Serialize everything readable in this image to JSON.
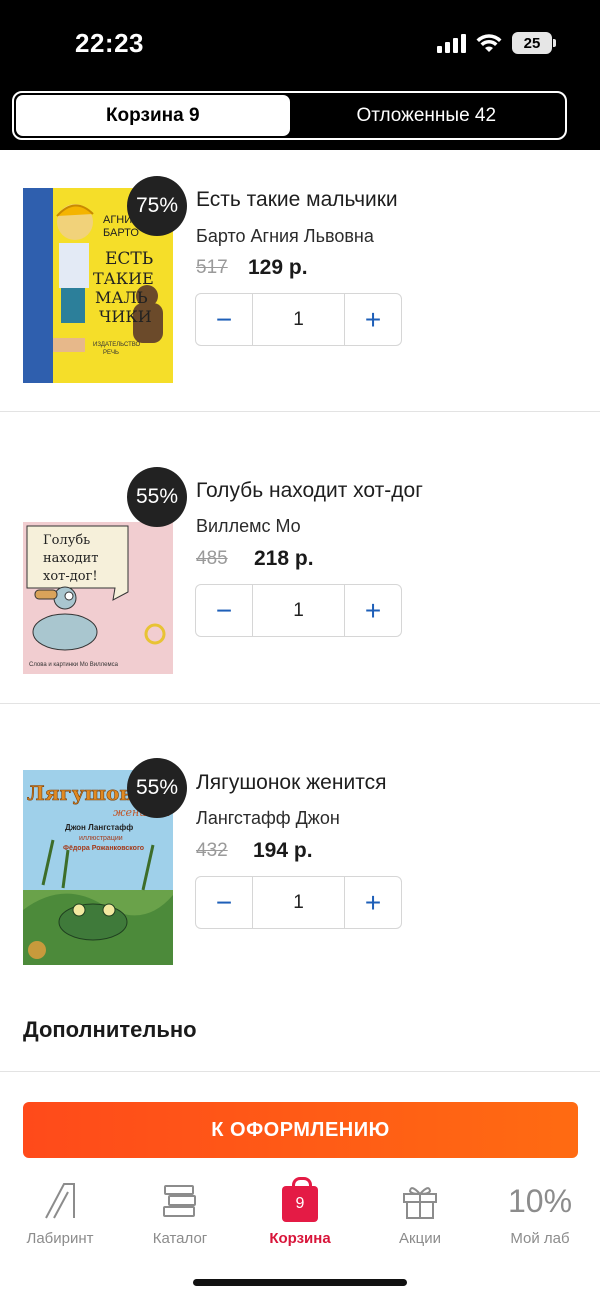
{
  "status_bar": {
    "time": "22:23",
    "battery": "25"
  },
  "segmented": {
    "tabs": [
      {
        "label": "Корзина 9",
        "active": true
      },
      {
        "label": "Отложенные 42",
        "active": false
      }
    ]
  },
  "cart_items": [
    {
      "discount": "75%",
      "title": "Есть такие мальчики",
      "author": "Барто Агния Львовна",
      "old_price": "517",
      "price": "129 р.",
      "quantity": "1",
      "cover_text": [
        "АГНИЯ",
        "БАРТО",
        "ЕСТЬ",
        "ТАКИЕ",
        "МАЛЬ",
        "ЧИКИ",
        "ИЗДАТЕЛЬСТВО",
        "РЕЧЬ"
      ]
    },
    {
      "discount": "55%",
      "title": "Голубь находит хот-дог",
      "author": "Виллемс Мо",
      "old_price": "485",
      "price": "218 р.",
      "quantity": "1",
      "cover_text": [
        "Голубь",
        "находит",
        "хот-дог!",
        "Слова и картинки Мо Виллемса"
      ]
    },
    {
      "discount": "55%",
      "title": "Лягушонок женится",
      "author": "Лангстафф Джон",
      "old_price": "432",
      "price": "194 р.",
      "quantity": "1",
      "cover_text": [
        "Лягушонок",
        "женится",
        "Джон Лангстафф",
        "иллюстрации",
        "Фёдора Рожанковского"
      ]
    }
  ],
  "stepper": {
    "minus": "−",
    "plus": "+"
  },
  "extra_section": {
    "title": "Дополнительно"
  },
  "checkout_button": "К ОФОРМЛЕНИЮ",
  "tabbar": {
    "items": [
      {
        "label": "Лабиринт",
        "icon": "labirint-logo-icon"
      },
      {
        "label": "Каталог",
        "icon": "books-stack-icon"
      },
      {
        "label": "Корзина",
        "icon": "shopping-bag-icon",
        "badge": "9",
        "active": true
      },
      {
        "label": "Акции",
        "icon": "gift-icon"
      },
      {
        "label": "Мой лаб",
        "icon": "percent-icon",
        "value": "10%"
      }
    ]
  },
  "colors": {
    "accent": "#e41b45",
    "checkout_start": "#ff4a1a",
    "checkout_end": "#ff6b12",
    "stepper_icon": "#1e5fb8"
  }
}
